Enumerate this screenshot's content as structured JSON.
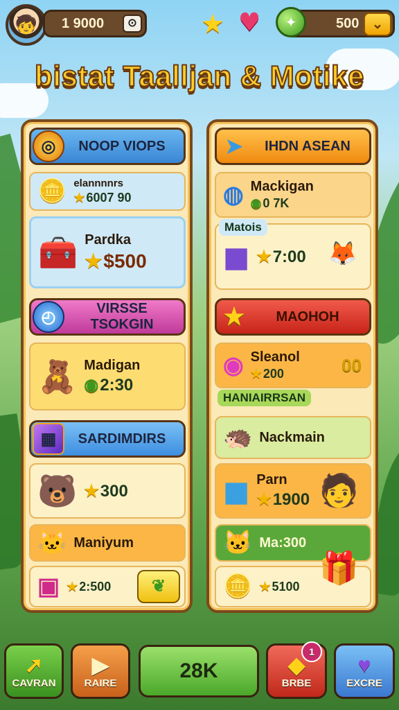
{
  "topbar": {
    "coins": "1 9000",
    "coins_btn": "⊙",
    "gems": "500",
    "gems_add": "⌄"
  },
  "title": "bistat Taalljan & Motike",
  "left_panel": {
    "header1": "NOOP VIOPS",
    "offer1": {
      "name": "elannnnrs",
      "price": "6007 90"
    },
    "offer2": {
      "name": "Pardka",
      "price": "$500"
    },
    "header2": "VIRSSE TSOKGIN",
    "offer3": {
      "name": "Madigan",
      "price": "2:30"
    },
    "header3": "SARDIMDIRS",
    "offer4": {
      "price": "300"
    },
    "offer5": {
      "name": "Maniyum"
    },
    "offer6": {
      "price": "2:500"
    }
  },
  "right_panel": {
    "header1": "IHDN ASEAN",
    "offer1": {
      "name": "Mackigan",
      "price": "0 7K"
    },
    "tag1": "Matois",
    "offer2": {
      "price": "7:00"
    },
    "header2": "MAOHOH",
    "offer3": {
      "name": "Sleanol",
      "price": "200",
      "badge": "00"
    },
    "tag2": "HANIAIRRSAN",
    "offer4": {
      "name": "Nackmain"
    },
    "offer5": {
      "name": "Parn",
      "price": "1900"
    },
    "offer6": {
      "name": "Ma:300"
    },
    "offer7": {
      "price": "5100"
    }
  },
  "bottom_nav": {
    "btn1": "CAVRAN",
    "btn2": "RAIRE",
    "center": "28K",
    "btn4": "BRBE",
    "btn4_badge": "1",
    "btn5": "EXCRE"
  }
}
